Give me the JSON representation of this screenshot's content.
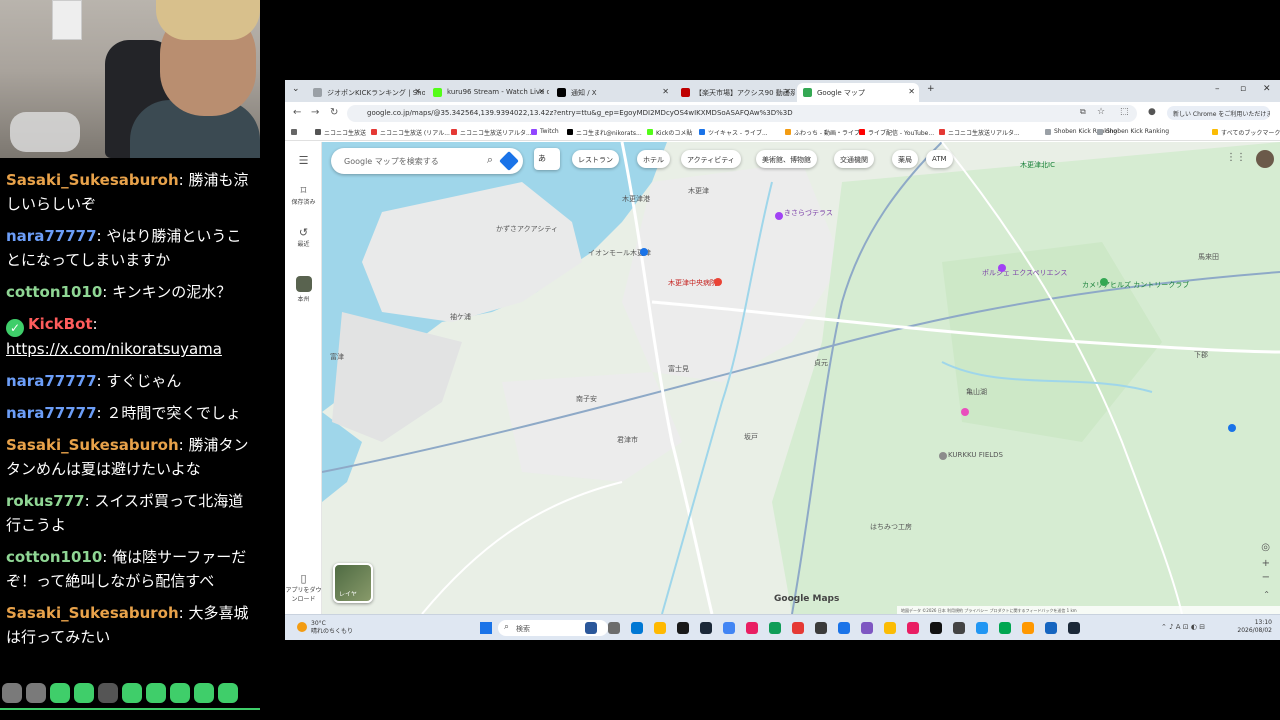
{
  "chat": {
    "messages": [
      {
        "user": "Sasaki_Sukesaburoh",
        "color": "#e8a24a",
        "text": "勝浦も涼しいらしいぞ"
      },
      {
        "user": "nara77777",
        "color": "#6c9ef8",
        "text": "やはり勝浦ということになってしまいますか"
      },
      {
        "user": "cotton1010",
        "color": "#8fd694",
        "text": "キンキンの泥水？"
      },
      {
        "user": "KickBot",
        "color": "#ff5c5c",
        "badge": "check-badge-icon",
        "link": "https://x.com/nikoratsuyama"
      },
      {
        "user": "nara77777",
        "color": "#6c9ef8",
        "text": "すぐじゃん"
      },
      {
        "user": "nara77777",
        "color": "#6c9ef8",
        "text": "２時間で突くでしょ"
      },
      {
        "user": "Sasaki_Sukesaburoh",
        "color": "#e8a24a",
        "text": "勝浦タンタンめんは夏は避けたいよな"
      },
      {
        "user": "rokus777",
        "color": "#8fd694",
        "text": "スイスポ買って北海道行こうよ"
      },
      {
        "user": "cotton1010",
        "color": "#8fd694",
        "text": "俺は陸サーファーだぞ！って絶叫しながら配信すべ"
      },
      {
        "user": "Sasaki_Sukesaburoh",
        "color": "#e8a24a",
        "text": "大多喜城は行ってみたい"
      }
    ]
  },
  "browser": {
    "tabs": [
      {
        "label": "ジオポンKICKランキング | Shoben K",
        "color": "#9aa0a6"
      },
      {
        "label": "kuru96 Stream - Watch Live on",
        "color": "#53fc18"
      },
      {
        "label": "通知 / X",
        "color": "#000000"
      },
      {
        "label": "【楽天市場】アクシス90 動画系の商",
        "color": "#bf0000"
      },
      {
        "label": "Google マップ",
        "color": "#34a853"
      }
    ],
    "url": "google.co.jp/maps/@35.342564,139.9394022,13.42z?entry=ttu&g_ep=EgoyMDI2MDcyOS4wIKXMDSoASAFQAw%3D%3D",
    "chrome_banner": "新しい Chrome をご利用いただけます",
    "bookmarks": [
      {
        "label": "ニコニコ生放送",
        "color": "#555555"
      },
      {
        "label": "ニコニコ生放送 (リアル...",
        "color": "#e53935"
      },
      {
        "label": "ニコニコ生放送リアルタ...",
        "color": "#e53935"
      },
      {
        "label": "Twitch",
        "color": "#9146ff"
      },
      {
        "label": "ニコ生まれ@nikorats...",
        "color": "#000000"
      },
      {
        "label": "Kickのコメ貼",
        "color": "#53fc18"
      },
      {
        "label": "ツイキャス - ライブ...",
        "color": "#1a73e8"
      },
      {
        "label": "ふわっち - 動画・ライブ...",
        "color": "#f39c12"
      },
      {
        "label": "ライブ配信 - YouTube...",
        "color": "#ff0000"
      },
      {
        "label": "ニコニコ生放送リアルタ...",
        "color": "#e53935"
      },
      {
        "label": "Shoben Kick Ranking",
        "color": "#9aa0a6"
      },
      {
        "label": "Shoben Kick Ranking",
        "color": "#9aa0a6"
      },
      {
        "label": "すべてのブックマーク",
        "color": "#fbbc04"
      }
    ]
  },
  "maps": {
    "sidebar": [
      {
        "icon": "menu-icon",
        "label": ""
      },
      {
        "icon": "bookmark-icon",
        "label": "保存済み"
      },
      {
        "icon": "history-icon",
        "label": "最近"
      },
      {
        "icon": "place-thumb-icon",
        "label": "本州"
      }
    ],
    "download_app": "アプリをダウンロード",
    "search_placeholder": "Google マップを検索する",
    "lang_chip": "あ",
    "chips": [
      "レストラン",
      "ホテル",
      "アクティビティ",
      "美術館、博物館",
      "交通機関",
      "薬局",
      "ATM"
    ],
    "labels": [
      {
        "text": "木更津港",
        "kind": ""
      },
      {
        "text": "木更津中央病院",
        "kind": "red"
      },
      {
        "text": "きさらづテラス",
        "kind": "poi"
      },
      {
        "text": "イオンモール木更津",
        "kind": ""
      },
      {
        "text": "袖ケ浦",
        "kind": ""
      },
      {
        "text": "君津市",
        "kind": ""
      },
      {
        "text": "南子安",
        "kind": ""
      },
      {
        "text": "富士見",
        "kind": ""
      },
      {
        "text": "坂戸",
        "kind": ""
      },
      {
        "text": "貞元",
        "kind": ""
      },
      {
        "text": "ポルシェ エクスペリエンス",
        "kind": "poi"
      },
      {
        "text": "カメリアヒルズ カントリークラブ",
        "kind": "green"
      },
      {
        "text": "KURKKU FIELDS",
        "kind": ""
      },
      {
        "text": "はちみつ工房",
        "kind": ""
      },
      {
        "text": "亀山湖",
        "kind": ""
      },
      {
        "text": "木更津北IC",
        "kind": "green"
      },
      {
        "text": "馬来田",
        "kind": ""
      },
      {
        "text": "下郡",
        "kind": ""
      },
      {
        "text": "かずさアクアシティ",
        "kind": ""
      },
      {
        "text": "富津",
        "kind": ""
      },
      {
        "text": "木更津",
        "kind": ""
      }
    ],
    "layer_label": "レイヤ",
    "watermark": "Google Maps",
    "footer": "地図データ ©2026 日本 利用規約 プライバシー プロダクトに関するフィードバックを送信 1 km"
  },
  "taskbar": {
    "weather_temp": "30°C",
    "weather_desc": "晴れのちくもり",
    "search_placeholder": "検索",
    "time": "13:10",
    "date": "2026/08/02",
    "icons": [
      "#2b579a",
      "#6c6c6c",
      "#0078d4",
      "#ffb900",
      "#1a1a1a",
      "#1b2838",
      "#4285f4",
      "#e91e63",
      "#0f9d58",
      "#e53935",
      "#3b3b3b",
      "#1a73e8",
      "#7e57c2",
      "#fbbc04",
      "#e91e63",
      "#111111",
      "#444444",
      "#2196f3",
      "#00a651",
      "#ff9800",
      "#1565c0",
      "#1b2838"
    ]
  }
}
